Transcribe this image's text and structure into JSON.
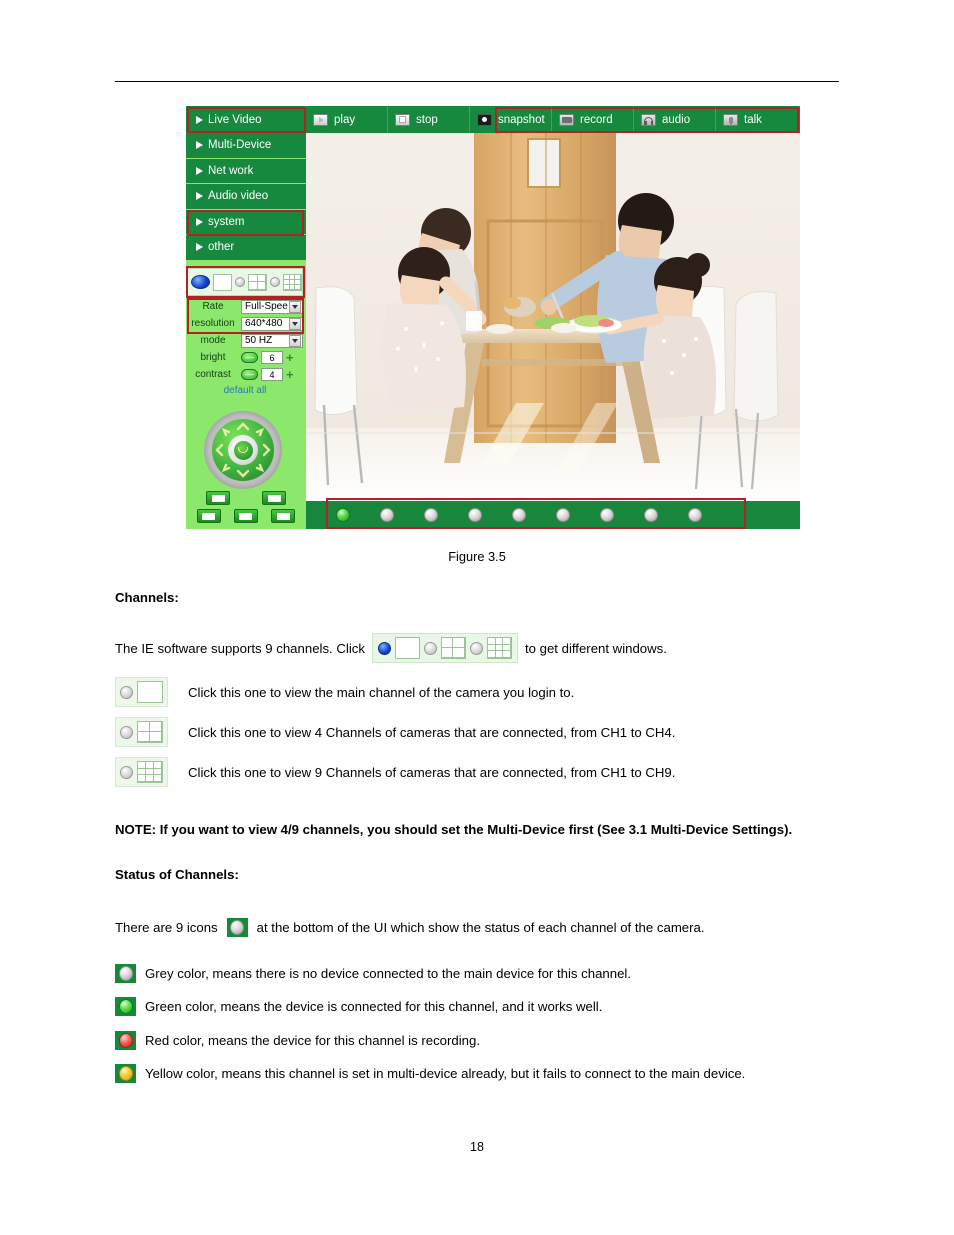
{
  "document": {
    "page_number": "18",
    "figure_caption": "Figure 3.5"
  },
  "app": {
    "menu": {
      "items": [
        {
          "label": "Live Video",
          "highlighted": true
        },
        {
          "label": "Multi-Device",
          "highlighted": false
        },
        {
          "label": "Net work",
          "highlighted": false
        },
        {
          "label": "Audio video",
          "highlighted": true
        },
        {
          "label": "system",
          "highlighted": false
        },
        {
          "label": "other",
          "highlighted": false
        }
      ]
    },
    "toolbar": {
      "buttons": [
        {
          "label": "play",
          "icon": "play-icon"
        },
        {
          "label": "stop",
          "icon": "stop-icon"
        },
        {
          "label": "snapshot",
          "icon": "snapshot-icon"
        },
        {
          "label": "record",
          "icon": "record-icon"
        },
        {
          "label": "audio",
          "icon": "audio-icon"
        },
        {
          "label": "talk",
          "icon": "talk-icon"
        }
      ]
    },
    "channel_selector": {
      "options": [
        {
          "layout": "1",
          "selected": true
        },
        {
          "layout": "4",
          "selected": false
        },
        {
          "layout": "9",
          "selected": false
        }
      ]
    },
    "settings": {
      "rate_label": "Rate",
      "rate_value": "Full-Spee",
      "resolution_label": "resolution",
      "resolution_value": "640*480",
      "mode_label": "mode",
      "mode_value": "50 HZ",
      "bright_label": "bright",
      "bright_value": "6",
      "contrast_label": "contrast",
      "contrast_value": "4",
      "minus_label": "—",
      "plus_label": "+",
      "default_all_label": "default all"
    },
    "status_channels": [
      {
        "state": "green"
      },
      {
        "state": "grey"
      },
      {
        "state": "grey"
      },
      {
        "state": "grey"
      },
      {
        "state": "grey"
      },
      {
        "state": "grey"
      },
      {
        "state": "grey"
      },
      {
        "state": "grey"
      },
      {
        "state": "grey"
      }
    ],
    "colors": {
      "menu_green": "#16893f",
      "panel_green": "#8be86b",
      "annotation_red": "#b22222",
      "selected_radio_blue": "#1340c8"
    }
  },
  "content": {
    "channels_heading": "Channels",
    "channels_heading_colon": ":",
    "channels_intro_pre": "The IE software supports 9 channels. Click",
    "channels_intro_post": "to get different windows.",
    "layout_1_text": "Click this one to view the main channel of the camera you login to.",
    "layout_4_text": "Click this one to view 4 Channels of cameras that are connected, from CH1 to CH4.",
    "layout_9_text": "Click this one to view 9 Channels of cameras that are connected, from CH1 to CH9.",
    "note_label": "NOTE",
    "note_colon": ":",
    "note_text": "If you want to view 4/9 channels, you should set the Multi-Device first (See 3.1 Multi-Device Settings).",
    "status_heading": "Status of Channels",
    "status_heading_colon": ":",
    "status_intro_pre": "There are 9 icons",
    "status_intro_post": "at the bottom of the UI which show the status of each channel of the camera.",
    "grey_text": "Grey color, means there is no device connected to the main device for this channel.",
    "green_text": "Green color, means the device is connected for this channel, and it works well.",
    "red_text": "Red color, means the device for this channel is recording.",
    "yellow_text": "Yellow color, means this channel is set in multi-device already, but it fails to connect to the main device."
  }
}
